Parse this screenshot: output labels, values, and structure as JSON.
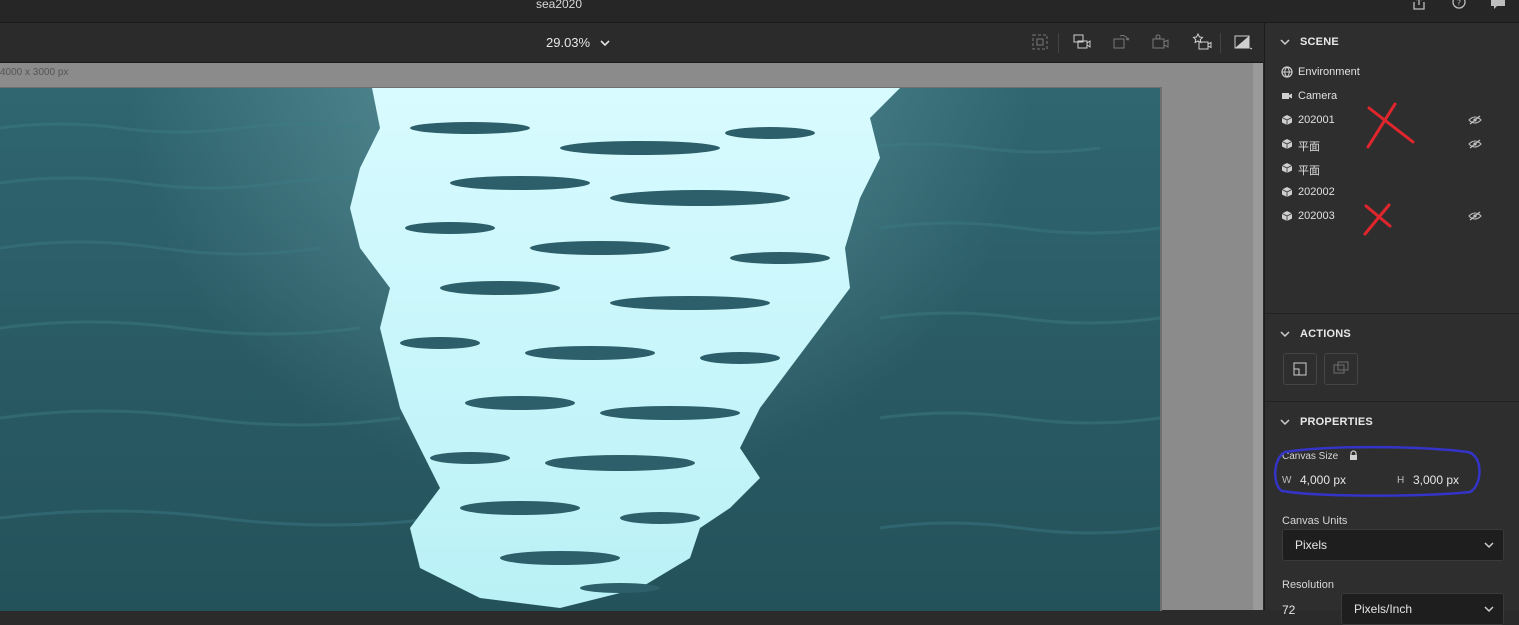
{
  "window": {
    "title": "sea2020",
    "icons": [
      "share-icon",
      "help-icon",
      "feedback-icon"
    ]
  },
  "toolbar": {
    "zoom": "29.03%",
    "tools": [
      "frame-icon",
      "camera-fit-icon",
      "rotate-view-icon",
      "camera-view-icon",
      "camera-bookmark-icon",
      "render-icon"
    ]
  },
  "canvas": {
    "dimensions_label": "4000 x 3000 px"
  },
  "panel": {
    "scene": {
      "title": "SCENE",
      "items": [
        {
          "label": "Environment",
          "icon": "globe-icon",
          "hidden": false
        },
        {
          "label": "Camera",
          "icon": "camera-icon",
          "hidden": false
        },
        {
          "label": "202001",
          "icon": "cube-icon",
          "hidden": true
        },
        {
          "label": "平面",
          "icon": "cube-icon",
          "hidden": true
        },
        {
          "label": "平面",
          "icon": "cube-icon",
          "hidden": false
        },
        {
          "label": "202002",
          "icon": "cube-icon",
          "hidden": false
        },
        {
          "label": "202003",
          "icon": "cube-icon",
          "hidden": true
        }
      ]
    },
    "actions": {
      "title": "ACTIONS"
    },
    "properties": {
      "title": "PROPERTIES",
      "canvas_size_label": "Canvas Size",
      "w_label": "W",
      "w_value": "4,000 px",
      "h_label": "H",
      "h_value": "3,000 px",
      "canvas_units_label": "Canvas Units",
      "canvas_units_value": "Pixels",
      "resolution_label": "Resolution",
      "resolution_value": "72",
      "resolution_unit": "Pixels/Inch"
    }
  },
  "colors": {
    "annotation_red": "#e0262c",
    "annotation_blue": "#3434c8",
    "water": "#2a5c66",
    "highlight": "#c8f6fa"
  }
}
